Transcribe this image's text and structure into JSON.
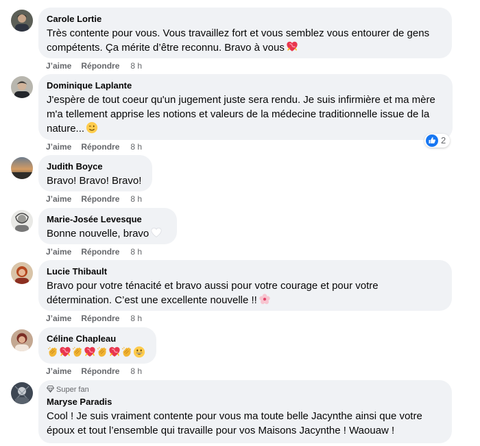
{
  "actions": {
    "like": "J’aime",
    "reply": "Répondre"
  },
  "comments": [
    {
      "author": "Carole Lortie",
      "text": "Très contente pour vous. Vous travaillez fort et vous semblez vous entourer de gens compétents. Ça mérite d’être reconnu. Bravo à vous",
      "emoji": "heart-ribbon",
      "time": "8 h"
    },
    {
      "author": "Dominique Laplante",
      "text": "J'espère de tout coeur qu'un jugement juste sera rendu. Je suis infirmière et ma mère m'a tellement apprise les notions et valeurs de la médecine traditionnelle issue de la nature...",
      "emoji": "winking-face",
      "time": "8 h",
      "reactions": {
        "icon": "like-icon",
        "count": "2"
      }
    },
    {
      "author": "Judith Boyce",
      "text": "Bravo! Bravo! Bravo!",
      "time": "8 h"
    },
    {
      "author": "Marie-Josée Levesque",
      "text": "Bonne nouvelle, bravo",
      "emoji": "white-heart",
      "time": "8 h"
    },
    {
      "author": "Lucie Thibault",
      "text": "Bravo pour votre ténacité et bravo aussi pour votre courage et pour votre détermination. C’est une excellente nouvelle !!",
      "emoji": "cherry-blossom",
      "time": "8 h"
    },
    {
      "author": "Céline Chapleau",
      "emoji_sequence": [
        "clap",
        "heart-ribbon",
        "clap",
        "heart-ribbon",
        "clap",
        "heart-ribbon",
        "clap",
        "grinning-face"
      ],
      "time": "8 h"
    },
    {
      "badge": "Super fan",
      "author": "Maryse Paradis",
      "text": "Cool ! Je suis vraiment contente pour vous ma toute belle Jacynthe ainsi que votre époux et tout l’ensemble qui travaille pour vos Maisons Jacynthe ! Waouaw !"
    }
  ]
}
